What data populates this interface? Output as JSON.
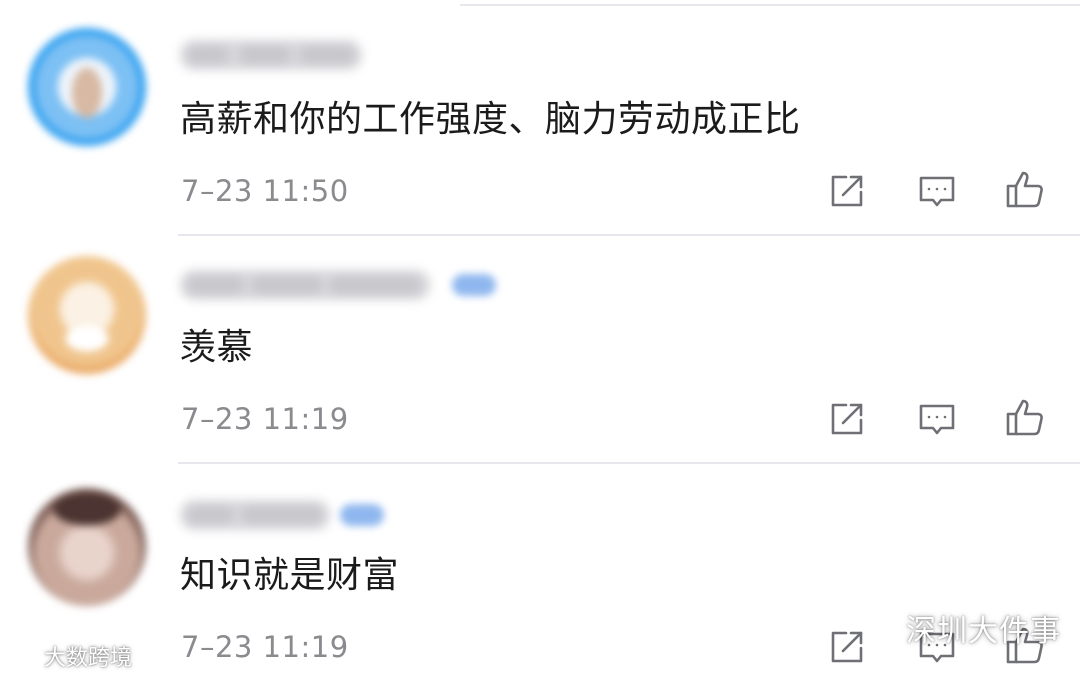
{
  "comments": [
    {
      "text": "高薪和你的工作强度、脑力劳动成正比",
      "time": "7–23 11:50"
    },
    {
      "text": "羡慕",
      "time": "7–23 11:19"
    },
    {
      "text": "知识就是财富",
      "time": "7–23 11:19"
    }
  ],
  "actions": {
    "share_icon": "share-icon",
    "reply_icon": "comment-icon",
    "like_icon": "thumbs-up-icon"
  },
  "watermarks": {
    "right": "深圳大件事",
    "left": "大数跨境"
  },
  "colors": {
    "text_primary": "#1b1b1b",
    "text_secondary": "#8a8a8f",
    "icon": "#6f6f76",
    "divider": "#e6e7ef"
  }
}
